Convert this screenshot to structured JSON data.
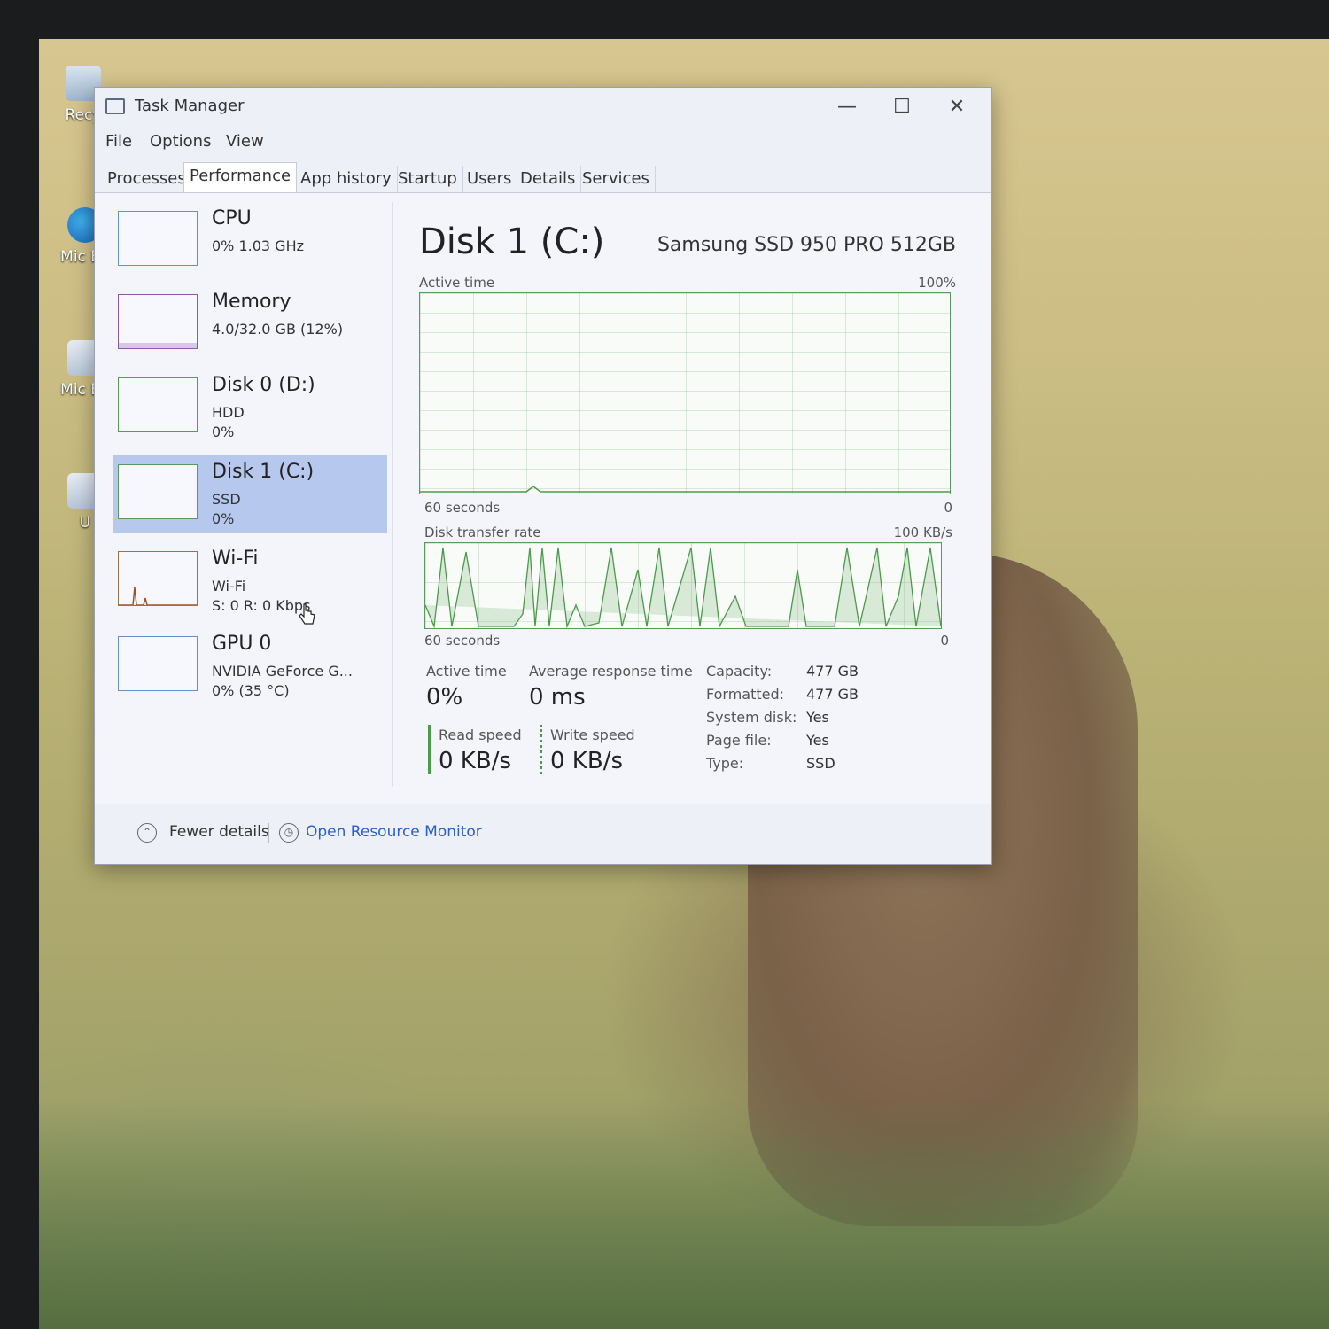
{
  "window": {
    "title": "Task Manager",
    "controls": {
      "minimize": "—",
      "maximize": "☐",
      "close": "✕"
    }
  },
  "desktop_icons": [
    "Recy",
    "Mic Ed",
    "Mic Ed",
    "U"
  ],
  "menu": [
    "File",
    "Options",
    "View"
  ],
  "tabs": [
    "Processes",
    "Performance",
    "App history",
    "Startup",
    "Users",
    "Details",
    "Services"
  ],
  "active_tab": "Performance",
  "sidebar": [
    {
      "name": "CPU",
      "lines": [
        "0% 1.03 GHz"
      ]
    },
    {
      "name": "Memory",
      "lines": [
        "4.0/32.0 GB (12%)"
      ]
    },
    {
      "name": "Disk 0 (D:)",
      "lines": [
        "HDD",
        "0%"
      ]
    },
    {
      "name": "Disk 1 (C:)",
      "lines": [
        "SSD",
        "0%"
      ]
    },
    {
      "name": "Wi-Fi",
      "lines": [
        "Wi-Fi",
        "S: 0 R: 0 Kbps"
      ]
    },
    {
      "name": "GPU 0",
      "lines": [
        "NVIDIA GeForce G...",
        "0% (35 °C)"
      ]
    }
  ],
  "selected_device": "Disk 1 (C:)",
  "detail": {
    "title": "Disk 1 (C:)",
    "model": "Samsung SSD 950 PRO 512GB",
    "active_graph": {
      "label": "Active time",
      "max": "100%",
      "time_left": "60 seconds",
      "time_right": "0"
    },
    "transfer_graph": {
      "label": "Disk transfer rate",
      "max": "100 KB/s",
      "time_left": "60 seconds",
      "time_right": "0"
    },
    "stats": {
      "active_time_label": "Active time",
      "active_time_value": "0%",
      "response_label": "Average response time",
      "response_value": "0 ms",
      "read_label": "Read speed",
      "read_value": "0 KB/s",
      "write_label": "Write speed",
      "write_value": "0 KB/s"
    },
    "properties": [
      {
        "label": "Capacity:",
        "value": "477 GB"
      },
      {
        "label": "Formatted:",
        "value": "477 GB"
      },
      {
        "label": "System disk:",
        "value": "Yes"
      },
      {
        "label": "Page file:",
        "value": "Yes"
      },
      {
        "label": "Type:",
        "value": "SSD"
      }
    ]
  },
  "footer": {
    "fewer_details": "Fewer details",
    "open_monitor": "Open Resource Monitor"
  },
  "colors": {
    "accent_disk": "#5a9a5a",
    "selected_bg": "#b6c8ee",
    "link": "#2a60c8"
  }
}
